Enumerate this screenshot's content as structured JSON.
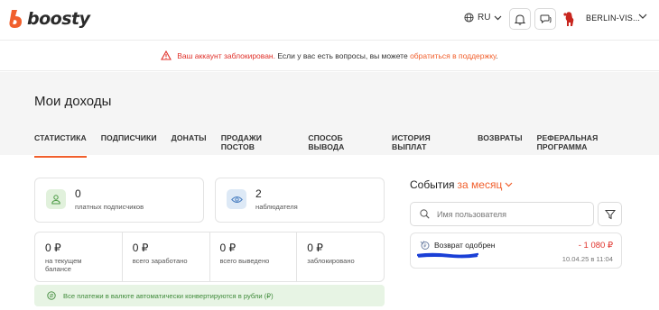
{
  "brand": {
    "logo_text": "boosty",
    "accent": "#f15f2c"
  },
  "header": {
    "lang": "RU",
    "user_name": "BERLIN-VIS..."
  },
  "alert": {
    "blocked": "Ваш аккаунт заблокирован.",
    "text": "Если у вас есть вопросы, вы можете",
    "link": "обратиться в поддержку",
    "end": "."
  },
  "page": {
    "title": "Мои доходы"
  },
  "tabs": [
    {
      "label": "СТАТИСТИКА",
      "active": true
    },
    {
      "label": "ПОДПИСЧИКИ"
    },
    {
      "label": "ДОНАТЫ"
    },
    {
      "label": "ПРОДАЖИ ПОСТОВ"
    },
    {
      "label": "СПОСОБ ВЫВОДА"
    },
    {
      "label": "ИСТОРИЯ ВЫПЛАТ"
    },
    {
      "label": "ВОЗВРАТЫ"
    },
    {
      "label": "РЕФЕРАЛЬНАЯ ПРОГРАММА"
    }
  ],
  "stats": {
    "subscribers": {
      "value": "0",
      "label": "платных подписчиков",
      "icon": "person-icon"
    },
    "watchers": {
      "value": "2",
      "label": "наблюдателя",
      "icon": "eye-icon"
    }
  },
  "balances": [
    {
      "value": "0 ₽",
      "label": "на текущем балансе"
    },
    {
      "value": "0 ₽",
      "label": "всего заработано"
    },
    {
      "value": "0 ₽",
      "label": "всего выведено"
    },
    {
      "value": "0 ₽",
      "label": "заблокировано"
    }
  ],
  "note": {
    "text": "Все платежи в валюте автоматически конвертируются в рубли (₽)",
    "icon": "currency-exchange-icon"
  },
  "events": {
    "title": "События",
    "period": "за месяц",
    "search_placeholder": "Имя пользователя",
    "items": [
      {
        "title": "Возврат одобрен",
        "amount": "- 1 080 ₽",
        "date": "10.04.25 в 11:04",
        "icon": "refund-icon"
      }
    ]
  }
}
